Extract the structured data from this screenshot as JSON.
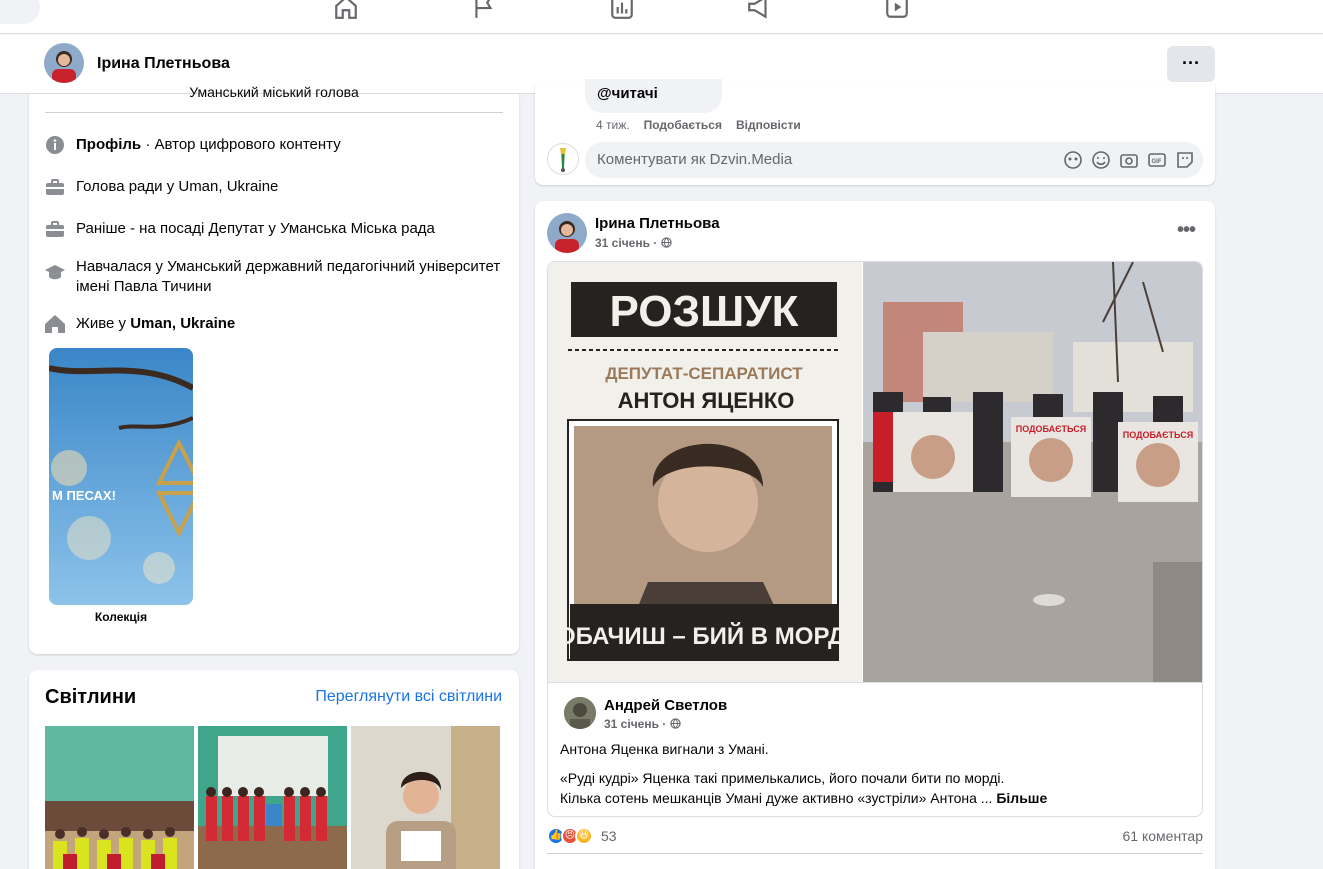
{
  "profile": {
    "name": "Ірина Плетньова",
    "more_label": "···"
  },
  "intro": {
    "cut_text": "Уманський міський голова",
    "rows": [
      {
        "icon": "info-icon",
        "bold": "Профіль",
        "text": " · Автор цифрового контенту"
      },
      {
        "icon": "briefcase-icon",
        "text": "Голова ради у Uman, Ukraine"
      },
      {
        "icon": "briefcase-icon",
        "text": "Раніше - на посаді Депутат у Уманська Міська рада"
      },
      {
        "icon": "graduation-cap-icon",
        "text": "Навчалася у Уманський державний педагогічний університет імені Павла Тичини"
      },
      {
        "icon": "home-icon",
        "text": "Живе у ",
        "bold": "Uman, Ukraine"
      }
    ],
    "collection_label": "Колекція",
    "collection_caption": "М ПЕСАХ!"
  },
  "photos": {
    "title": "Світлини",
    "link": "Переглянути всі світлини"
  },
  "prev_comment": {
    "mention": "@читачі",
    "age": "4 тиж.",
    "like": "Подобається",
    "reply": "Відповісти",
    "input_placeholder": "Коментувати як Dzvin.Media"
  },
  "post": {
    "author": "Ірина Плетньова",
    "date": "31 січень ·",
    "dots": "•••",
    "poster": {
      "headline": "РОЗШУК",
      "subtitle": "ДЕПУТАТ-СЕПАРАТИСТ",
      "name": "АНТОН ЯЦЕНКО",
      "slogan": "ПОБАЧИШ – БИЙ В МОРДУ!"
    },
    "photo_signs": [
      "ПОДОБАЄТЬСЯ",
      "ПОДОБАЄТЬСЯ"
    ],
    "shared": {
      "author": "Андрей Светлов",
      "date": "31 січень ·",
      "line1": "Антона Яценка вигнали з Умані.",
      "line2": "«Руді кудрі» Яценка такі примелькались, його почали бити по морді.",
      "line3": "Кілька сотень мешканців Умані дуже активно «зустріли» Антона ... ",
      "more": "Більше"
    },
    "reaction_count": "53",
    "comment_count": "61 коментар"
  },
  "colors": {
    "accent": "#1b74e4",
    "bg": "#f0f2f5"
  }
}
